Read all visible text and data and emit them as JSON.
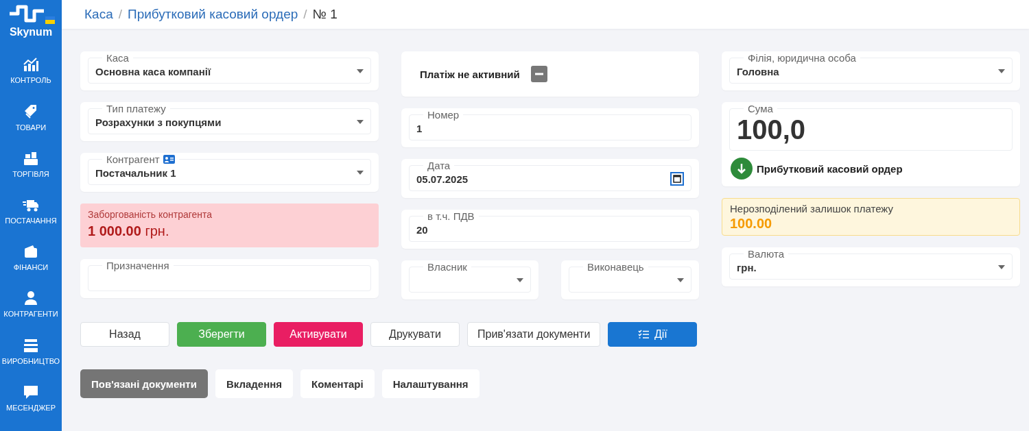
{
  "sidebar": {
    "logo": "Skynum",
    "items": [
      {
        "label": "КОНТРОЛЬ"
      },
      {
        "label": "ТОВАРИ"
      },
      {
        "label": "ТОРГІВЛЯ"
      },
      {
        "label": "ПОСТАЧАННЯ"
      },
      {
        "label": "ФІНАНСИ"
      },
      {
        "label": "КОНТРАГЕНТИ"
      },
      {
        "label": "ВИРОБНИЦТВО"
      },
      {
        "label": "МЕСЕНДЖЕР"
      }
    ]
  },
  "breadcrumb": [
    {
      "label": "Каса",
      "kind": "link"
    },
    {
      "label": "/",
      "kind": "separator"
    },
    {
      "label": "Прибутковий касовий ордер",
      "kind": "link"
    },
    {
      "label": "/",
      "kind": "separator"
    },
    {
      "label": "№ 1",
      "kind": "current"
    }
  ],
  "columns": [
    [
      {
        "kind": "select",
        "label": "Каса",
        "value": "Основна каса компанії"
      },
      {
        "kind": "select",
        "label": "Тип платежу",
        "value": "Розрахунки з покупцями"
      },
      {
        "kind": "select",
        "label": "Контрагент",
        "value": "Постачальник 1",
        "contact_card": true
      },
      {
        "kind": "alert",
        "label": "Заборгованість контрагента",
        "amount": "1 000.00",
        "currency": "грн."
      },
      {
        "kind": "input",
        "label": "Призначення"
      }
    ],
    [
      {
        "kind": "status",
        "label": "Платіж не активний"
      },
      {
        "kind": "input",
        "label": "Номер",
        "value": "1"
      },
      {
        "kind": "date",
        "label": "Дата",
        "value": "05.07.2025"
      },
      {
        "kind": "input",
        "label": "в т.ч. ПДВ",
        "value": "20"
      },
      {
        "kind": "pair",
        "fields": [
          {
            "label": "Власник"
          },
          {
            "label": "Виконавець"
          }
        ]
      }
    ],
    [
      {
        "kind": "select",
        "label": "Філія, юридична особа",
        "value": "Головна"
      },
      {
        "kind": "amount",
        "label": "Сума",
        "value": "100,0",
        "doc_type": "Прибутковий касовий ордер"
      },
      {
        "kind": "balance",
        "label": "Нерозподілений залишок платежу",
        "value": "100.00"
      },
      {
        "kind": "select",
        "label": "Валюта",
        "value": "грн."
      }
    ]
  ],
  "buttons": [
    {
      "label": "Назад",
      "kind": "default"
    },
    {
      "label": "Зберегти",
      "kind": "success"
    },
    {
      "label": "Активувати",
      "kind": "danger"
    },
    {
      "label": "Друкувати",
      "kind": "default"
    },
    {
      "label": "Прив'язати документи",
      "kind": "default"
    },
    {
      "label": "Дії",
      "kind": "primary"
    }
  ],
  "tabs": [
    {
      "label": "Пов'язані документи",
      "selected": true
    },
    {
      "label": "Вкладення",
      "selected": false
    },
    {
      "label": "Коментарі",
      "selected": false
    },
    {
      "label": "Налаштування",
      "selected": false
    }
  ]
}
